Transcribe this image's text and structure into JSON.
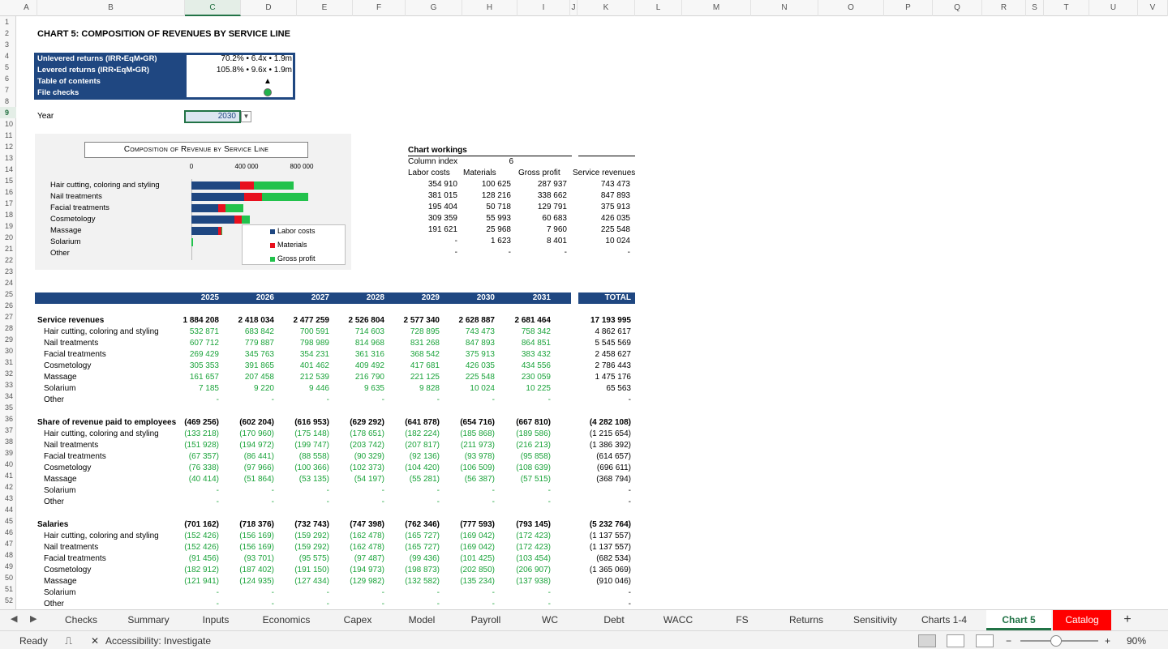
{
  "columns": [
    "A",
    "B",
    "C",
    "D",
    "E",
    "F",
    "G",
    "H",
    "I",
    "J",
    "K",
    "L",
    "M",
    "N",
    "O",
    "P",
    "Q",
    "R",
    "S",
    "T",
    "U",
    "V"
  ],
  "selected_column": "C",
  "selected_row": "9",
  "rows": [
    "1",
    "2",
    "3",
    "4",
    "5",
    "6",
    "7",
    "8",
    "9",
    "10",
    "11",
    "12",
    "13",
    "14",
    "15",
    "16",
    "17",
    "18",
    "19",
    "20",
    "21",
    "22",
    "23",
    "24",
    "25",
    "26",
    "27",
    "28",
    "29",
    "30",
    "31",
    "32",
    "33",
    "34",
    "35",
    "36",
    "37",
    "38",
    "39",
    "40",
    "41",
    "42",
    "43",
    "44",
    "45",
    "46",
    "47",
    "48",
    "49",
    "50",
    "51",
    "52"
  ],
  "sheet_title": "CHART 5: COMPOSITION OF REVENUES BY SERVICE LINE",
  "info_box": {
    "labels": [
      "Unlevered returns (IRR•EqM•GR)",
      "Levered returns (IRR•EqM•GR)",
      "Table of contents",
      "File checks"
    ],
    "values": [
      "70.2% • 6.4x • 1.9m",
      "105.8% • 9.6x • 1.9m",
      "▲",
      ""
    ],
    "check_color": "#22b24c"
  },
  "year": {
    "label": "Year",
    "value": "2030"
  },
  "chart_data": {
    "type": "bar",
    "stacked": true,
    "orientation": "horizontal",
    "title": "Composition of Revenue by Service Line",
    "categories": [
      "Hair cutting, coloring and styling",
      "Nail treatments",
      "Facial treatments",
      "Cosmetology",
      "Massage",
      "Solarium",
      "Other"
    ],
    "series": [
      {
        "name": "Labor costs",
        "color": "#1f4781",
        "values": [
          354910,
          381015,
          195404,
          309359,
          191621,
          0,
          0
        ]
      },
      {
        "name": "Materials",
        "color": "#e8101e",
        "values": [
          100625,
          128216,
          50718,
          55993,
          25968,
          1623,
          0
        ]
      },
      {
        "name": "Gross profit",
        "color": "#22c24c",
        "values": [
          287937,
          338662,
          129791,
          60683,
          7960,
          8401,
          0
        ]
      }
    ],
    "xlim": [
      0,
      1200000
    ],
    "xticks": [
      "0",
      "400 000",
      "800 000"
    ],
    "xtick_values": [
      0,
      400000,
      800000
    ],
    "legend_position": "bottom-right"
  },
  "workings": {
    "title": "Chart workings",
    "index_label": "Column index",
    "index_value": "6",
    "headers": [
      "Labor costs",
      "Materials",
      "Gross profit",
      "Service revenues"
    ],
    "rows": [
      [
        "354 910",
        "100 625",
        "287 937",
        "743 473"
      ],
      [
        "381 015",
        "128 216",
        "338 662",
        "847 893"
      ],
      [
        "195 404",
        "50 718",
        "129 791",
        "375 913"
      ],
      [
        "309 359",
        "55 993",
        "60 683",
        "426 035"
      ],
      [
        "191 621",
        "25 968",
        "7 960",
        "225 548"
      ],
      [
        "-",
        "1 623",
        "8 401",
        "10 024"
      ],
      [
        "-",
        "-",
        "-",
        "-"
      ]
    ]
  },
  "table": {
    "years": [
      "2025",
      "2026",
      "2027",
      "2028",
      "2029",
      "2030",
      "2031"
    ],
    "total_label": "TOTAL",
    "sections": [
      {
        "title": "Service revenues",
        "totals": [
          "1 884 208",
          "2 418 034",
          "2 477 259",
          "2 526 804",
          "2 577 340",
          "2 628 887",
          "2 681 464",
          "17 193 995"
        ],
        "lines": [
          {
            "label": "Hair cutting, coloring and styling",
            "vals": [
              "532 871",
              "683 842",
              "700 591",
              "714 603",
              "728 895",
              "743 473",
              "758 342",
              "4 862 617"
            ]
          },
          {
            "label": "Nail treatments",
            "vals": [
              "607 712",
              "779 887",
              "798 989",
              "814 968",
              "831 268",
              "847 893",
              "864 851",
              "5 545 569"
            ]
          },
          {
            "label": "Facial treatments",
            "vals": [
              "269 429",
              "345 763",
              "354 231",
              "361 316",
              "368 542",
              "375 913",
              "383 432",
              "2 458 627"
            ]
          },
          {
            "label": "Cosmetology",
            "vals": [
              "305 353",
              "391 865",
              "401 462",
              "409 492",
              "417 681",
              "426 035",
              "434 556",
              "2 786 443"
            ]
          },
          {
            "label": "Massage",
            "vals": [
              "161 657",
              "207 458",
              "212 539",
              "216 790",
              "221 125",
              "225 548",
              "230 059",
              "1 475 176"
            ]
          },
          {
            "label": "Solarium",
            "vals": [
              "7 185",
              "9 220",
              "9 446",
              "9 635",
              "9 828",
              "10 024",
              "10 225",
              "65 563"
            ]
          },
          {
            "label": "Other",
            "vals": [
              "-",
              "-",
              "-",
              "-",
              "-",
              "-",
              "-",
              "-"
            ]
          }
        ]
      },
      {
        "title": "Share of revenue paid to employees",
        "totals": [
          "(469 256)",
          "(602 204)",
          "(616 953)",
          "(629 292)",
          "(641 878)",
          "(654 716)",
          "(667 810)",
          "(4 282 108)"
        ],
        "lines": [
          {
            "label": "Hair cutting, coloring and styling",
            "vals": [
              "(133 218)",
              "(170 960)",
              "(175 148)",
              "(178 651)",
              "(182 224)",
              "(185 868)",
              "(189 586)",
              "(1 215 654)"
            ]
          },
          {
            "label": "Nail treatments",
            "vals": [
              "(151 928)",
              "(194 972)",
              "(199 747)",
              "(203 742)",
              "(207 817)",
              "(211 973)",
              "(216 213)",
              "(1 386 392)"
            ]
          },
          {
            "label": "Facial treatments",
            "vals": [
              "(67 357)",
              "(86 441)",
              "(88 558)",
              "(90 329)",
              "(92 136)",
              "(93 978)",
              "(95 858)",
              "(614 657)"
            ]
          },
          {
            "label": "Cosmetology",
            "vals": [
              "(76 338)",
              "(97 966)",
              "(100 366)",
              "(102 373)",
              "(104 420)",
              "(106 509)",
              "(108 639)",
              "(696 611)"
            ]
          },
          {
            "label": "Massage",
            "vals": [
              "(40 414)",
              "(51 864)",
              "(53 135)",
              "(54 197)",
              "(55 281)",
              "(56 387)",
              "(57 515)",
              "(368 794)"
            ]
          },
          {
            "label": "Solarium",
            "vals": [
              "-",
              "-",
              "-",
              "-",
              "-",
              "-",
              "-",
              "-"
            ]
          },
          {
            "label": "Other",
            "vals": [
              "-",
              "-",
              "-",
              "-",
              "-",
              "-",
              "-",
              "-"
            ]
          }
        ]
      },
      {
        "title": "Salaries",
        "totals": [
          "(701 162)",
          "(718 376)",
          "(732 743)",
          "(747 398)",
          "(762 346)",
          "(777 593)",
          "(793 145)",
          "(5 232 764)"
        ],
        "lines": [
          {
            "label": "Hair cutting, coloring and styling",
            "vals": [
              "(152 426)",
              "(156 169)",
              "(159 292)",
              "(162 478)",
              "(165 727)",
              "(169 042)",
              "(172 423)",
              "(1 137 557)"
            ]
          },
          {
            "label": "Nail treatments",
            "vals": [
              "(152 426)",
              "(156 169)",
              "(159 292)",
              "(162 478)",
              "(165 727)",
              "(169 042)",
              "(172 423)",
              "(1 137 557)"
            ]
          },
          {
            "label": "Facial treatments",
            "vals": [
              "(91 456)",
              "(93 701)",
              "(95 575)",
              "(97 487)",
              "(99 436)",
              "(101 425)",
              "(103 454)",
              "(682 534)"
            ]
          },
          {
            "label": "Cosmetology",
            "vals": [
              "(182 912)",
              "(187 402)",
              "(191 150)",
              "(194 973)",
              "(198 873)",
              "(202 850)",
              "(206 907)",
              "(1 365 069)"
            ]
          },
          {
            "label": "Massage",
            "vals": [
              "(121 941)",
              "(124 935)",
              "(127 434)",
              "(129 982)",
              "(132 582)",
              "(135 234)",
              "(137 938)",
              "(910 046)"
            ]
          },
          {
            "label": "Solarium",
            "vals": [
              "-",
              "-",
              "-",
              "-",
              "-",
              "-",
              "-",
              "-"
            ]
          },
          {
            "label": "Other",
            "vals": [
              "-",
              "-",
              "-",
              "-",
              "-",
              "-",
              "-",
              "-"
            ]
          }
        ]
      }
    ]
  },
  "tabs": [
    "Checks",
    "Summary",
    "Inputs",
    "Economics",
    "Capex",
    "Model",
    "Payroll",
    "WC",
    "Debt",
    "WACC",
    "FS",
    "Returns",
    "Sensitivity",
    "Charts 1-4",
    "Chart 5",
    "Catalog"
  ],
  "active_tab": "Chart 5",
  "add_sheet": "+",
  "status": {
    "ready": "Ready",
    "accessibility": "Accessibility: Investigate",
    "zoom": "90%",
    "zoom_minus": "−",
    "zoom_plus": "+"
  }
}
